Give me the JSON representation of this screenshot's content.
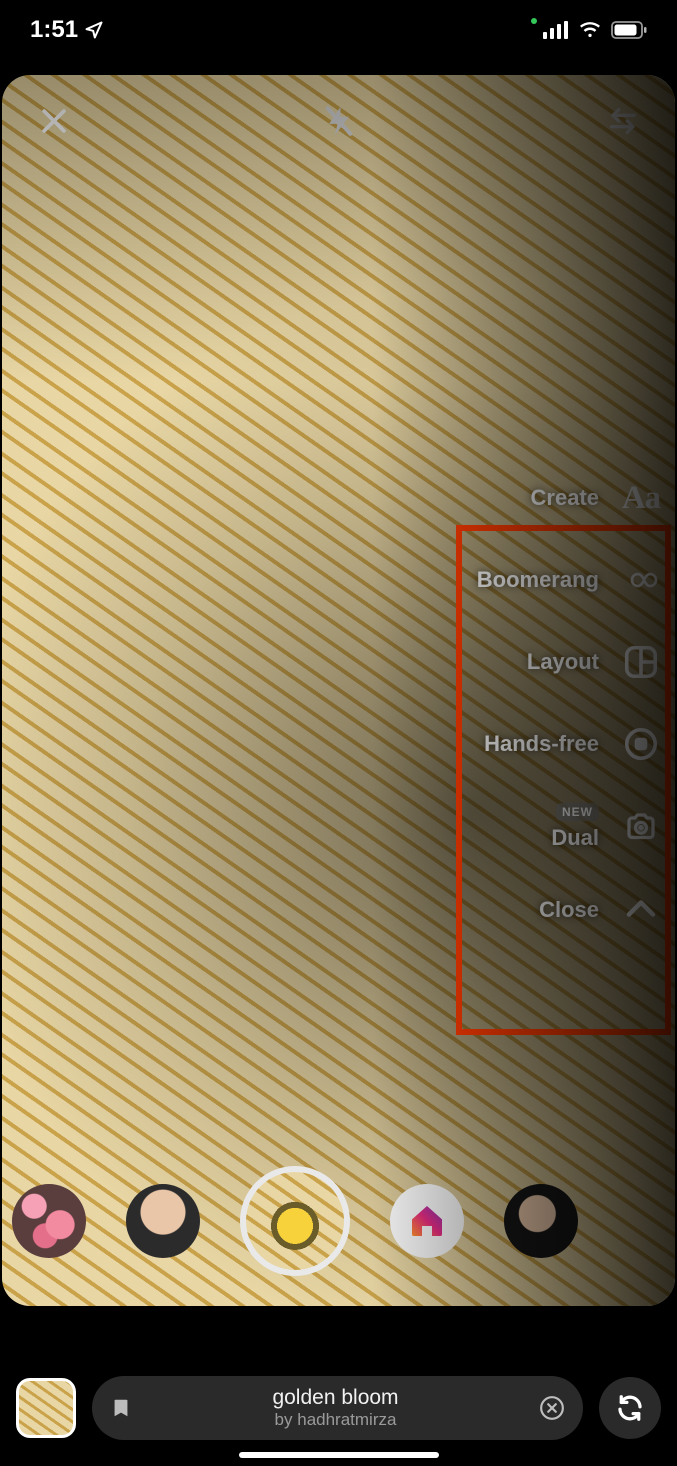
{
  "status": {
    "time": "1:51"
  },
  "tools": {
    "create": {
      "label": "Create"
    },
    "boomerang": {
      "label": "Boomerang"
    },
    "layout": {
      "label": "Layout"
    },
    "handsfree": {
      "label": "Hands-free"
    },
    "dual": {
      "label": "Dual",
      "badge": "NEW"
    },
    "close": {
      "label": "Close"
    }
  },
  "effect_pill": {
    "title": "golden bloom",
    "by_prefix": "by ",
    "author": "hadhratmirza"
  }
}
